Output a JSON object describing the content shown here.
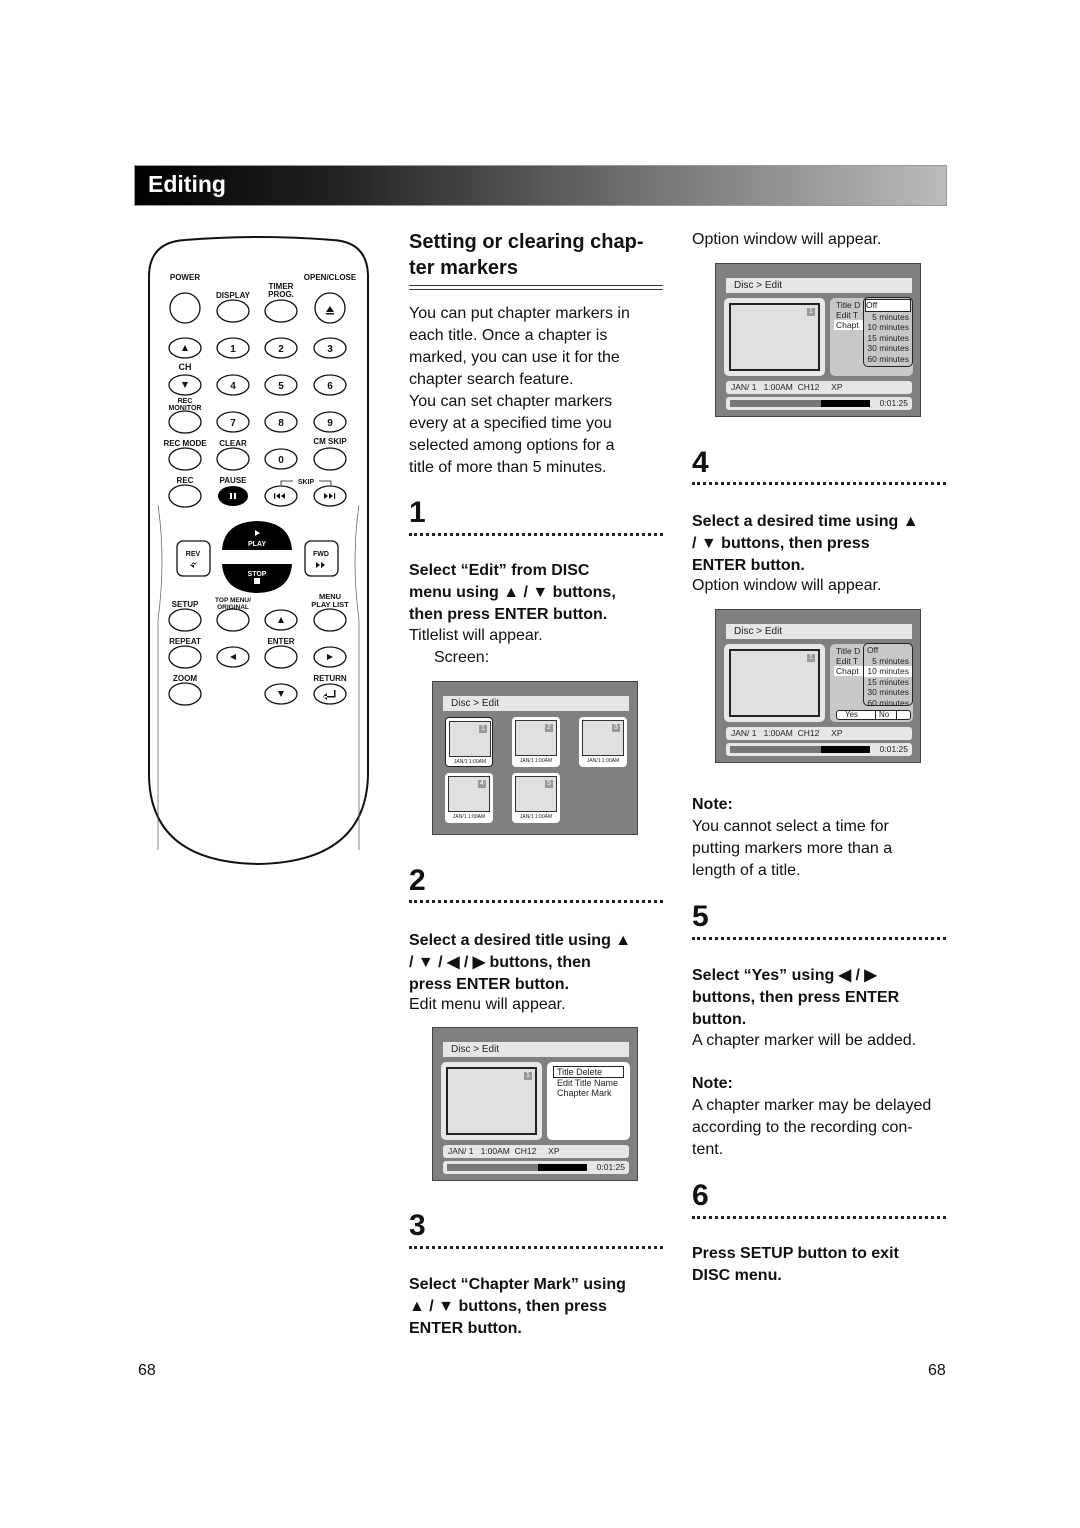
{
  "header": {
    "title": "Editing"
  },
  "remote": {
    "power": "POWER",
    "open_close": "OPEN/CLOSE",
    "display": "DISPLAY",
    "timer": "TIMER",
    "prog": "PROG.",
    "ch": "CH",
    "rec_top": "REC",
    "monitor": "MONITOR",
    "rec_mode": "REC MODE",
    "clear": "CLEAR",
    "cm_skip": "CM SKIP",
    "rec": "REC",
    "pause": "PAUSE",
    "skip": "SKIP",
    "play": "PLAY",
    "stop": "STOP",
    "rev": "REV",
    "fwd": "FWD",
    "setup": "SETUP",
    "top_menu": "TOP MENU/",
    "original": "ORIGINAL",
    "menu": "MENU",
    "play_list": "PLAY LIST",
    "repeat": "REPEAT",
    "enter": "ENTER",
    "zoom": "ZOOM",
    "return": "RETURN",
    "digits": [
      "1",
      "2",
      "3",
      "4",
      "5",
      "6",
      "7",
      "8",
      "9",
      "0"
    ]
  },
  "section": {
    "title_l1": "Setting or clearing chap-",
    "title_l2": "ter markers",
    "intro": [
      "You can put chapter markers in",
      "each title. Once a chapter is",
      "marked, you can use it for the",
      "chapter search feature.",
      "You can set chapter markers",
      "every at a specified time you",
      "selected among options for a",
      "title of more than 5 minutes."
    ]
  },
  "steps": [
    {
      "num": "1",
      "bold": [
        "Select “Edit” from DISC",
        "menu using ▲ / ▼ buttons,",
        "then press ENTER button."
      ],
      "after": [
        "Titlelist will appear.",
        "Screen:"
      ]
    },
    {
      "num": "2",
      "bold": [
        "Select a desired title using ▲",
        "/ ▼ / ◀ / ▶ buttons, then",
        "press ENTER button."
      ],
      "after": [
        "Edit menu will appear."
      ]
    },
    {
      "num": "3",
      "bold": [
        "Select “Chapter Mark” using",
        "▲ / ▼ buttons, then press",
        "ENTER button."
      ]
    },
    {
      "num": "4",
      "bold": [
        "Select a desired time using ▲",
        "/ ▼ buttons, then press",
        "ENTER button."
      ],
      "after": [
        "Option window will appear."
      ]
    },
    {
      "num": "5",
      "bold": [
        "Select “Yes” using ◀ / ▶",
        "buttons, then press ENTER",
        "button."
      ],
      "after": [
        "A chapter marker will be added."
      ]
    },
    {
      "num": "6",
      "bold": [
        "Press SETUP button to exit",
        "DISC menu."
      ]
    }
  ],
  "right_top": "Option window will appear.",
  "notes": [
    {
      "label": "Note:",
      "lines": [
        "You cannot select a time for",
        "putting markers more than a",
        "length of a title."
      ]
    },
    {
      "label": "Note:",
      "lines": [
        "A chapter marker may be delayed",
        "according to the recording con-",
        "tent."
      ]
    }
  ],
  "screen": {
    "breadcrumb": "Disc > Edit",
    "tiles": [
      {
        "num": "1",
        "date": "JAN/1   1:00AM"
      },
      {
        "num": "2",
        "date": "JAN/1   1:00AM"
      },
      {
        "num": "3",
        "date": "JAN/1   1:00AM"
      },
      {
        "num": "4",
        "date": "JAN/1   1:00AM"
      },
      {
        "num": "5",
        "date": "JAN/1   1:00AM"
      }
    ],
    "title_num": "1",
    "menu": [
      "Title Delete",
      "Edit Title Name",
      "Chapter Mark"
    ],
    "menu_cut": [
      "Title D",
      "Edit T",
      "Chapt"
    ],
    "options": [
      "Off",
      "5 minutes",
      "10 minutes",
      "15 minutes",
      "30 minutes",
      "60 minutes"
    ],
    "yes": "Yes",
    "no": "No",
    "info": "JAN/ 1   1:00AM  CH12     XP",
    "time": "0:01:25",
    "progress": 0.65
  },
  "page_numbers": {
    "left": "68",
    "right": "68"
  }
}
